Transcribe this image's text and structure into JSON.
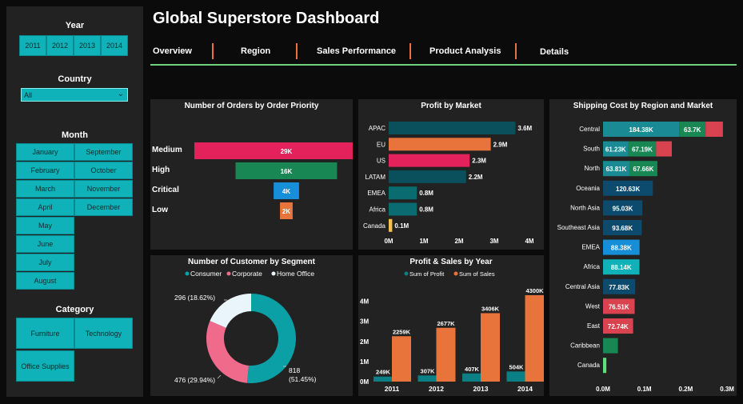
{
  "header": {
    "title": "Global Superstore Dashboard"
  },
  "nav": {
    "tabs": [
      "Overview",
      "Region",
      "Sales Performance",
      "Product Analysis",
      "Details"
    ]
  },
  "filters": {
    "year": {
      "label": "Year",
      "options": [
        "2011",
        "2012",
        "2013",
        "2014"
      ]
    },
    "country": {
      "label": "Country",
      "value": "All"
    },
    "month": {
      "label": "Month",
      "options": [
        "January",
        "February",
        "March",
        "April",
        "May",
        "June",
        "July",
        "August",
        "September",
        "October",
        "November",
        "December"
      ]
    },
    "category": {
      "label": "Category",
      "options": [
        "Furniture",
        "Technology",
        "Office Supplies"
      ]
    }
  },
  "colors": {
    "teal": "#0fb2b8",
    "pink": "#e3215a",
    "green": "#198754",
    "blue": "#168fd8",
    "orange": "#e8743b",
    "yellow": "#f2c14e",
    "dark_teal": "#0a5560",
    "navy": "#0c4a6e"
  },
  "panels": {
    "orders": "Number of Orders by Order Priority",
    "profit_market": "Profit by Market",
    "shipping": "Shipping Cost by Region and Market",
    "segment": "Number of Customer by Segment",
    "profit_sales": "Profit & Sales by Year"
  },
  "chart_data": [
    {
      "id": "orders",
      "type": "bar",
      "title": "Number of Orders by Order Priority",
      "categories": [
        "Medium",
        "High",
        "Critical",
        "Low"
      ],
      "values": [
        29000,
        16000,
        4000,
        2000
      ],
      "labels": [
        "29K",
        "16K",
        "4K",
        "2K"
      ],
      "colors": [
        "#e3215a",
        "#198754",
        "#168fd8",
        "#e8743b"
      ]
    },
    {
      "id": "profit_market",
      "type": "bar",
      "title": "Profit by Market",
      "categories": [
        "APAC",
        "EU",
        "US",
        "LATAM",
        "EMEA",
        "Africa",
        "Canada"
      ],
      "values": [
        3.6,
        2.9,
        2.3,
        2.2,
        0.8,
        0.8,
        0.1
      ],
      "labels": [
        "3.6M",
        "2.9M",
        "2.3M",
        "2.2M",
        "0.8M",
        "0.8M",
        "0.1M"
      ],
      "colors": [
        "#0a4f5c",
        "#e8743b",
        "#e3215a",
        "#0a4f5c",
        "#0a6b70",
        "#0a6b70",
        "#f2c14e"
      ],
      "x_ticks": [
        "0M",
        "1M",
        "2M",
        "3M",
        "4M"
      ],
      "xlim": [
        0,
        4
      ]
    },
    {
      "id": "shipping",
      "type": "bar",
      "title": "Shipping Cost by Region and Market",
      "rows": [
        {
          "region": "Central",
          "segments": [
            {
              "value": 184.38,
              "label": "184.38K",
              "color": "#1a8a94"
            },
            {
              "value": 63.7,
              "label": "63.7K",
              "color": "#198754"
            },
            {
              "value": 42,
              "label": "",
              "color": "#d9434f"
            }
          ]
        },
        {
          "region": "South",
          "segments": [
            {
              "value": 61.23,
              "label": "61.23K",
              "color": "#1a8a94"
            },
            {
              "value": 67.19,
              "label": "67.19K",
              "color": "#198754"
            },
            {
              "value": 38,
              "label": "",
              "color": "#d9434f"
            }
          ]
        },
        {
          "region": "North",
          "segments": [
            {
              "value": 63.81,
              "label": "63.81K",
              "color": "#1a8a94"
            },
            {
              "value": 67.66,
              "label": "67.66K",
              "color": "#198754"
            }
          ]
        },
        {
          "region": "Oceania",
          "segments": [
            {
              "value": 120.63,
              "label": "120.63K",
              "color": "#0c4a6e"
            }
          ]
        },
        {
          "region": "North Asia",
          "segments": [
            {
              "value": 95.03,
              "label": "95.03K",
              "color": "#0c4a6e"
            }
          ]
        },
        {
          "region": "Southeast Asia",
          "segments": [
            {
              "value": 93.68,
              "label": "93.68K",
              "color": "#0c4a6e"
            }
          ]
        },
        {
          "region": "EMEA",
          "segments": [
            {
              "value": 88.38,
              "label": "88.38K",
              "color": "#168fd8"
            }
          ]
        },
        {
          "region": "Africa",
          "segments": [
            {
              "value": 88.14,
              "label": "88.14K",
              "color": "#0fb2b8"
            }
          ]
        },
        {
          "region": "Central Asia",
          "segments": [
            {
              "value": 77.83,
              "label": "77.83K",
              "color": "#0c4a6e"
            }
          ]
        },
        {
          "region": "West",
          "segments": [
            {
              "value": 76.51,
              "label": "76.51K",
              "color": "#d9434f"
            }
          ]
        },
        {
          "region": "East",
          "segments": [
            {
              "value": 72.74,
              "label": "72.74K",
              "color": "#d9434f"
            }
          ]
        },
        {
          "region": "Caribbean",
          "segments": [
            {
              "value": 36,
              "label": "",
              "color": "#198754"
            }
          ]
        },
        {
          "region": "Canada",
          "segments": [
            {
              "value": 8,
              "label": "",
              "color": "#5ee07a"
            }
          ]
        }
      ],
      "x_ticks": [
        "0.0M",
        "0.1M",
        "0.2M",
        "0.3M"
      ],
      "xlim": [
        0,
        300
      ]
    },
    {
      "id": "segment",
      "type": "pie",
      "title": "Number of Customer by Segment",
      "legend": [
        "Consumer",
        "Corporate",
        "Home Office"
      ],
      "values": [
        818,
        476,
        296
      ],
      "labels": [
        "818 (51.45%)",
        "476 (29.94%)",
        "296 (18.62%)"
      ],
      "colors": [
        "#0aa0a6",
        "#f06b8b",
        "#eaf4fb"
      ]
    },
    {
      "id": "profit_sales",
      "type": "bar",
      "title": "Profit & Sales by Year",
      "categories": [
        "2011",
        "2012",
        "2013",
        "2014"
      ],
      "series": [
        {
          "name": "Sum of Profit",
          "values": [
            249,
            307,
            407,
            504
          ],
          "labels": [
            "249K",
            "307K",
            "407K",
            "504K"
          ],
          "color": "#0a7f85"
        },
        {
          "name": "Sum of Sales",
          "values": [
            2259,
            2677,
            3406,
            4300
          ],
          "labels": [
            "2259K",
            "2677K",
            "3406K",
            "4300K"
          ],
          "color": "#e8743b"
        }
      ],
      "y_ticks": [
        "0M",
        "1M",
        "2M",
        "3M",
        "4M"
      ],
      "ylim": [
        0,
        4300
      ]
    }
  ]
}
